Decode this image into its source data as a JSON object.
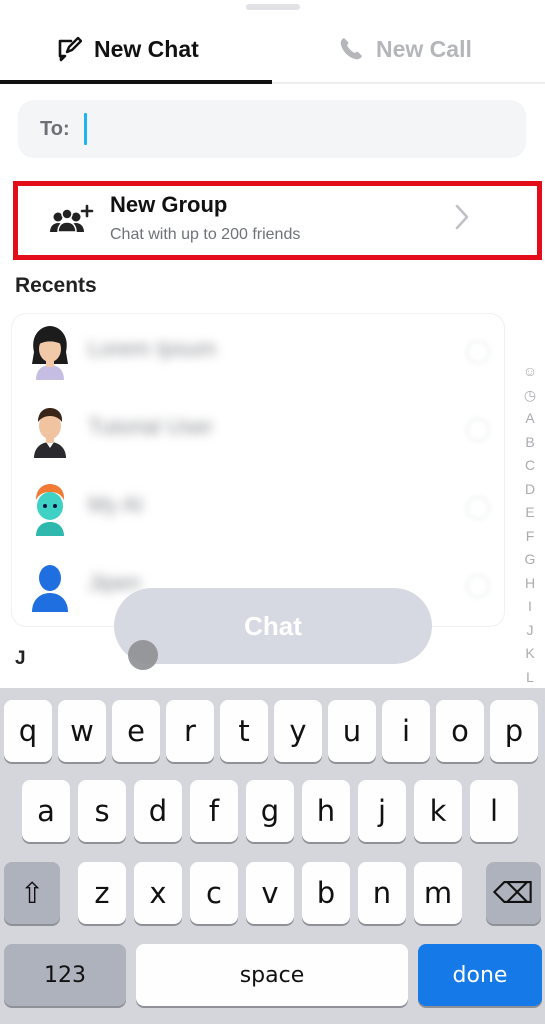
{
  "tabs": {
    "new_chat": "New Chat",
    "new_call": "New Call"
  },
  "to_field": {
    "label": "To:",
    "value": ""
  },
  "new_group": {
    "title": "New Group",
    "subtitle": "Chat with up to 200 friends"
  },
  "recents": {
    "label": "Recents",
    "items": [
      {
        "name": "Lorem Ipsum",
        "avatar": "woman-avatar-icon"
      },
      {
        "name": "Tutorial User",
        "avatar": "man-avatar-icon"
      },
      {
        "name": "My AI",
        "avatar": "ai-avatar-icon"
      },
      {
        "name": "Jipen",
        "avatar": "silhouette-avatar-icon"
      }
    ]
  },
  "alpha_index": [
    "☺",
    "◷",
    "A",
    "B",
    "C",
    "D",
    "E",
    "F",
    "G",
    "H",
    "I",
    "J",
    "K",
    "L"
  ],
  "section_header": "J",
  "chat_button": "Chat",
  "keyboard": {
    "row1": [
      "q",
      "w",
      "e",
      "r",
      "t",
      "y",
      "u",
      "i",
      "o",
      "p"
    ],
    "row2": [
      "a",
      "s",
      "d",
      "f",
      "g",
      "h",
      "j",
      "k",
      "l"
    ],
    "row3": [
      "z",
      "x",
      "c",
      "v",
      "b",
      "n",
      "m"
    ],
    "numbers": "123",
    "space": "space",
    "done": "done",
    "shift": "⇧",
    "backspace": "⌫"
  },
  "colors": {
    "highlight_border": "#e30d1a",
    "caret": "#1fb4ef",
    "done_key": "#1579e8"
  }
}
